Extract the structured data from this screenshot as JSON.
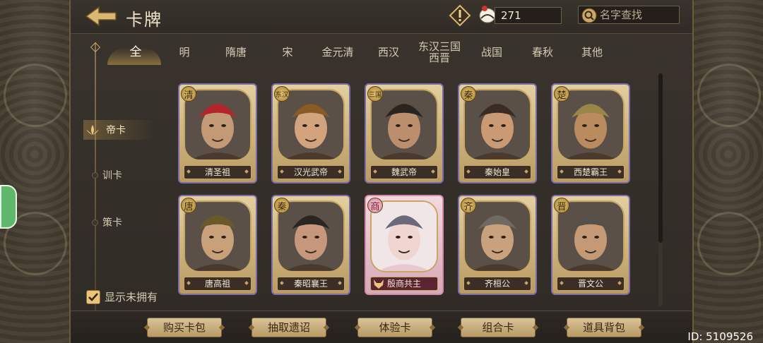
{
  "header": {
    "title": "卡牌",
    "resource_count": "271",
    "search_placeholder": "名字查找"
  },
  "tabs": [
    {
      "label": "全",
      "active": true
    },
    {
      "label": "明"
    },
    {
      "label": "隋唐"
    },
    {
      "label": "宋"
    },
    {
      "label": "金元清"
    },
    {
      "label": "西汉"
    },
    {
      "label": "东汉三国",
      "label2": "西晋"
    },
    {
      "label": "战国"
    },
    {
      "label": "春秋"
    },
    {
      "label": "其他"
    }
  ],
  "categories": [
    {
      "label": "帝卡",
      "active": true
    },
    {
      "label": "训卡"
    },
    {
      "label": "策卡"
    }
  ],
  "cards": [
    {
      "name": "清圣祖",
      "badge": "清",
      "rarity": "purple"
    },
    {
      "name": "汉光武帝",
      "badge": "东汉",
      "rarity": "purple"
    },
    {
      "name": "魏武帝",
      "badge": "三国",
      "rarity": "purple"
    },
    {
      "name": "秦始皇",
      "badge": "秦",
      "rarity": "purple"
    },
    {
      "name": "西楚霸王",
      "badge": "楚",
      "rarity": "purple"
    },
    {
      "name": "唐高祖",
      "badge": "唐",
      "rarity": "purple"
    },
    {
      "name": "秦昭襄王",
      "badge": "秦",
      "rarity": "purple"
    },
    {
      "name": "殷商共主",
      "badge": "商",
      "rarity": "pink"
    },
    {
      "name": "齐桓公",
      "badge": "齐",
      "rarity": "purple"
    },
    {
      "name": "晋文公",
      "badge": "晋",
      "rarity": "purple"
    }
  ],
  "show_unowned": {
    "label": "显示未拥有",
    "checked": true
  },
  "bottom_buttons": [
    "购买卡包",
    "抽取遗诏",
    "体验卡",
    "组合卡",
    "道具背包"
  ],
  "watermark": "ID: 5109526",
  "colors": {
    "accent": "#e9c47b",
    "panel": "#3a342d",
    "purple_border": "#7d6ca8",
    "pink_border": "#d48aa8"
  }
}
